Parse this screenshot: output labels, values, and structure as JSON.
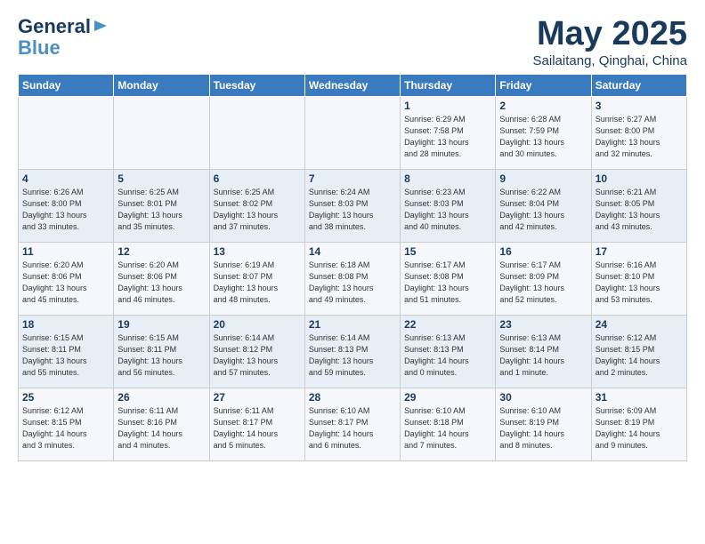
{
  "logo": {
    "line1": "General",
    "line2": "Blue"
  },
  "title": "May 2025",
  "subtitle": "Sailaitang, Qinghai, China",
  "days_of_week": [
    "Sunday",
    "Monday",
    "Tuesday",
    "Wednesday",
    "Thursday",
    "Friday",
    "Saturday"
  ],
  "weeks": [
    [
      {
        "day": "",
        "info": ""
      },
      {
        "day": "",
        "info": ""
      },
      {
        "day": "",
        "info": ""
      },
      {
        "day": "",
        "info": ""
      },
      {
        "day": "1",
        "info": "Sunrise: 6:29 AM\nSunset: 7:58 PM\nDaylight: 13 hours\nand 28 minutes."
      },
      {
        "day": "2",
        "info": "Sunrise: 6:28 AM\nSunset: 7:59 PM\nDaylight: 13 hours\nand 30 minutes."
      },
      {
        "day": "3",
        "info": "Sunrise: 6:27 AM\nSunset: 8:00 PM\nDaylight: 13 hours\nand 32 minutes."
      }
    ],
    [
      {
        "day": "4",
        "info": "Sunrise: 6:26 AM\nSunset: 8:00 PM\nDaylight: 13 hours\nand 33 minutes."
      },
      {
        "day": "5",
        "info": "Sunrise: 6:25 AM\nSunset: 8:01 PM\nDaylight: 13 hours\nand 35 minutes."
      },
      {
        "day": "6",
        "info": "Sunrise: 6:25 AM\nSunset: 8:02 PM\nDaylight: 13 hours\nand 37 minutes."
      },
      {
        "day": "7",
        "info": "Sunrise: 6:24 AM\nSunset: 8:03 PM\nDaylight: 13 hours\nand 38 minutes."
      },
      {
        "day": "8",
        "info": "Sunrise: 6:23 AM\nSunset: 8:03 PM\nDaylight: 13 hours\nand 40 minutes."
      },
      {
        "day": "9",
        "info": "Sunrise: 6:22 AM\nSunset: 8:04 PM\nDaylight: 13 hours\nand 42 minutes."
      },
      {
        "day": "10",
        "info": "Sunrise: 6:21 AM\nSunset: 8:05 PM\nDaylight: 13 hours\nand 43 minutes."
      }
    ],
    [
      {
        "day": "11",
        "info": "Sunrise: 6:20 AM\nSunset: 8:06 PM\nDaylight: 13 hours\nand 45 minutes."
      },
      {
        "day": "12",
        "info": "Sunrise: 6:20 AM\nSunset: 8:06 PM\nDaylight: 13 hours\nand 46 minutes."
      },
      {
        "day": "13",
        "info": "Sunrise: 6:19 AM\nSunset: 8:07 PM\nDaylight: 13 hours\nand 48 minutes."
      },
      {
        "day": "14",
        "info": "Sunrise: 6:18 AM\nSunset: 8:08 PM\nDaylight: 13 hours\nand 49 minutes."
      },
      {
        "day": "15",
        "info": "Sunrise: 6:17 AM\nSunset: 8:08 PM\nDaylight: 13 hours\nand 51 minutes."
      },
      {
        "day": "16",
        "info": "Sunrise: 6:17 AM\nSunset: 8:09 PM\nDaylight: 13 hours\nand 52 minutes."
      },
      {
        "day": "17",
        "info": "Sunrise: 6:16 AM\nSunset: 8:10 PM\nDaylight: 13 hours\nand 53 minutes."
      }
    ],
    [
      {
        "day": "18",
        "info": "Sunrise: 6:15 AM\nSunset: 8:11 PM\nDaylight: 13 hours\nand 55 minutes."
      },
      {
        "day": "19",
        "info": "Sunrise: 6:15 AM\nSunset: 8:11 PM\nDaylight: 13 hours\nand 56 minutes."
      },
      {
        "day": "20",
        "info": "Sunrise: 6:14 AM\nSunset: 8:12 PM\nDaylight: 13 hours\nand 57 minutes."
      },
      {
        "day": "21",
        "info": "Sunrise: 6:14 AM\nSunset: 8:13 PM\nDaylight: 13 hours\nand 59 minutes."
      },
      {
        "day": "22",
        "info": "Sunrise: 6:13 AM\nSunset: 8:13 PM\nDaylight: 14 hours\nand 0 minutes."
      },
      {
        "day": "23",
        "info": "Sunrise: 6:13 AM\nSunset: 8:14 PM\nDaylight: 14 hours\nand 1 minute."
      },
      {
        "day": "24",
        "info": "Sunrise: 6:12 AM\nSunset: 8:15 PM\nDaylight: 14 hours\nand 2 minutes."
      }
    ],
    [
      {
        "day": "25",
        "info": "Sunrise: 6:12 AM\nSunset: 8:15 PM\nDaylight: 14 hours\nand 3 minutes."
      },
      {
        "day": "26",
        "info": "Sunrise: 6:11 AM\nSunset: 8:16 PM\nDaylight: 14 hours\nand 4 minutes."
      },
      {
        "day": "27",
        "info": "Sunrise: 6:11 AM\nSunset: 8:17 PM\nDaylight: 14 hours\nand 5 minutes."
      },
      {
        "day": "28",
        "info": "Sunrise: 6:10 AM\nSunset: 8:17 PM\nDaylight: 14 hours\nand 6 minutes."
      },
      {
        "day": "29",
        "info": "Sunrise: 6:10 AM\nSunset: 8:18 PM\nDaylight: 14 hours\nand 7 minutes."
      },
      {
        "day": "30",
        "info": "Sunrise: 6:10 AM\nSunset: 8:19 PM\nDaylight: 14 hours\nand 8 minutes."
      },
      {
        "day": "31",
        "info": "Sunrise: 6:09 AM\nSunset: 8:19 PM\nDaylight: 14 hours\nand 9 minutes."
      }
    ]
  ]
}
